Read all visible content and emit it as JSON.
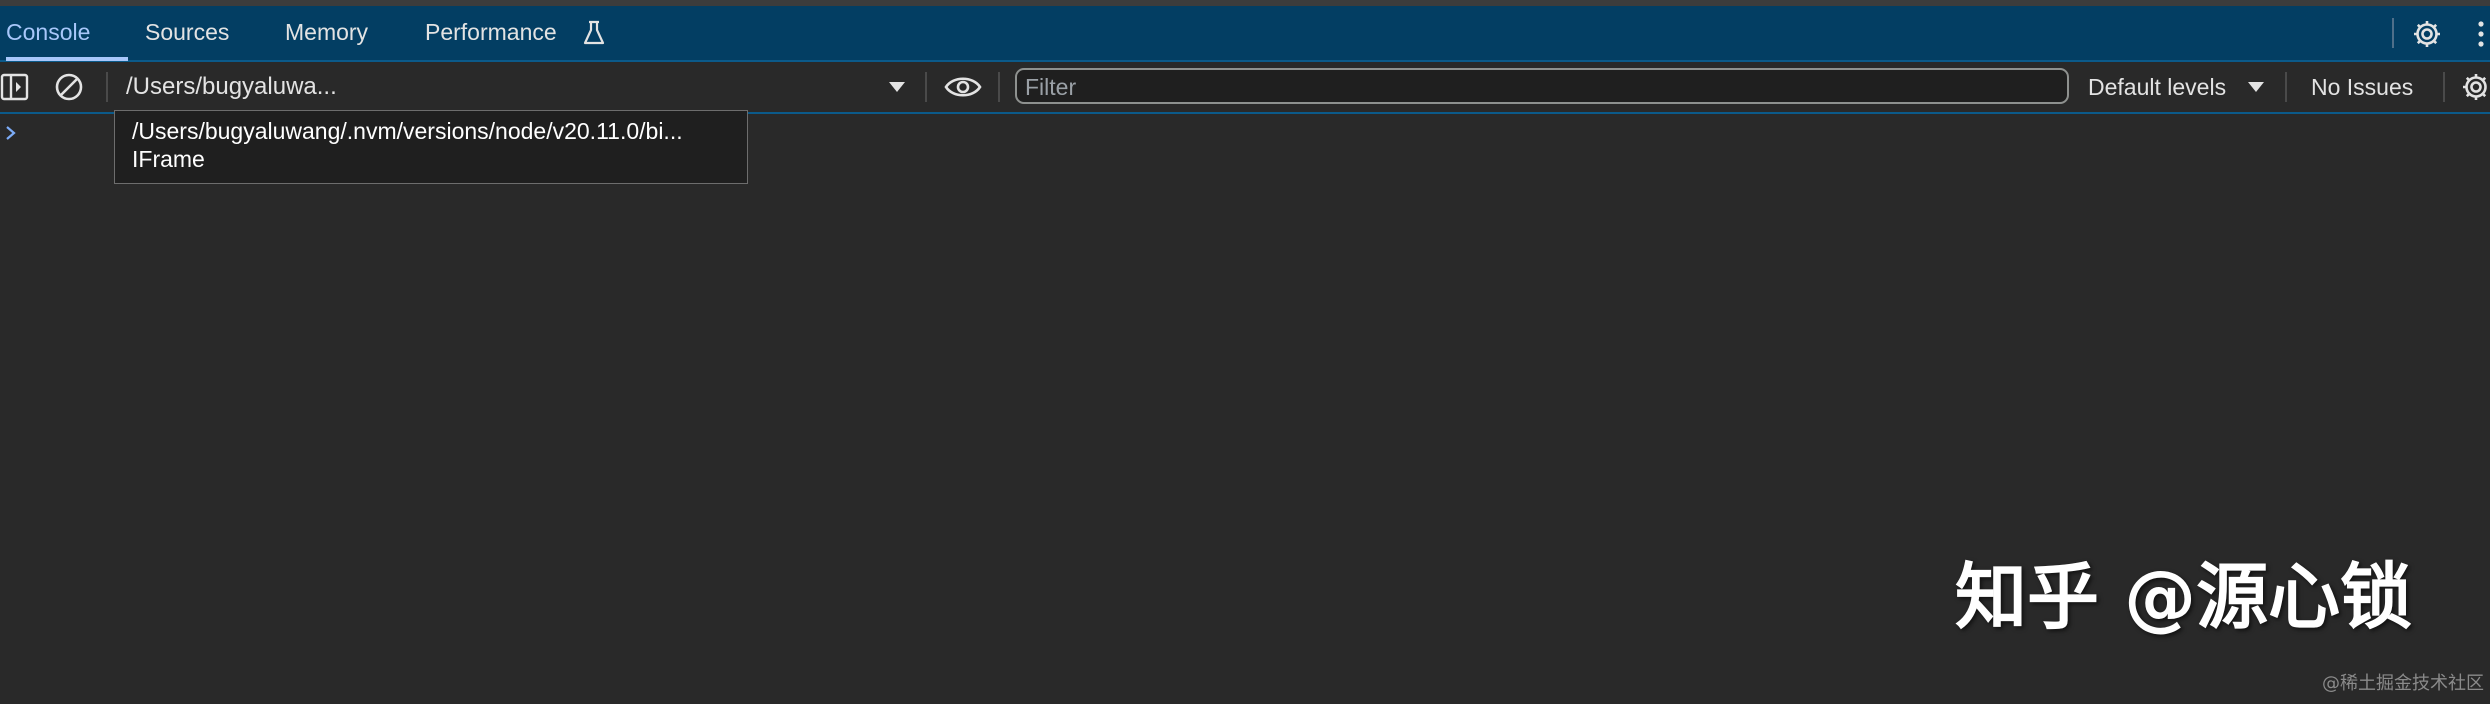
{
  "tabs": [
    {
      "label": "Console",
      "active": true
    },
    {
      "label": "Sources",
      "active": false
    },
    {
      "label": "Memory",
      "active": false
    },
    {
      "label": "Performance",
      "active": false,
      "icon": "flask-icon"
    }
  ],
  "tabbar_icons": [
    "gear-icon",
    "kebab-menu-icon"
  ],
  "toolbar": {
    "sidebar_icon": "sidebar-toggle-icon",
    "clear_icon": "clear-console-icon",
    "context_selector": "/Users/bugyaluwa...",
    "eye_icon": "live-expression-eye-icon",
    "filter_placeholder": "Filter",
    "filter_value": "",
    "levels": "Default levels",
    "issues": "No Issues"
  },
  "tooltip": {
    "line1": "/Users/bugyaluwang/.nvm/versions/node/v20.11.0/bi...",
    "line2": "IFrame"
  },
  "console": {
    "prompt_icon": "prompt-chevron-icon"
  },
  "watermark": {
    "text": "知乎 @源心锁",
    "source": "@稀土掘金技术社区"
  },
  "colors": {
    "tabbar_bg": "#033e63",
    "accent": "#a8c7fa",
    "panel_bg": "#292929",
    "text": "#e3e3e3"
  }
}
